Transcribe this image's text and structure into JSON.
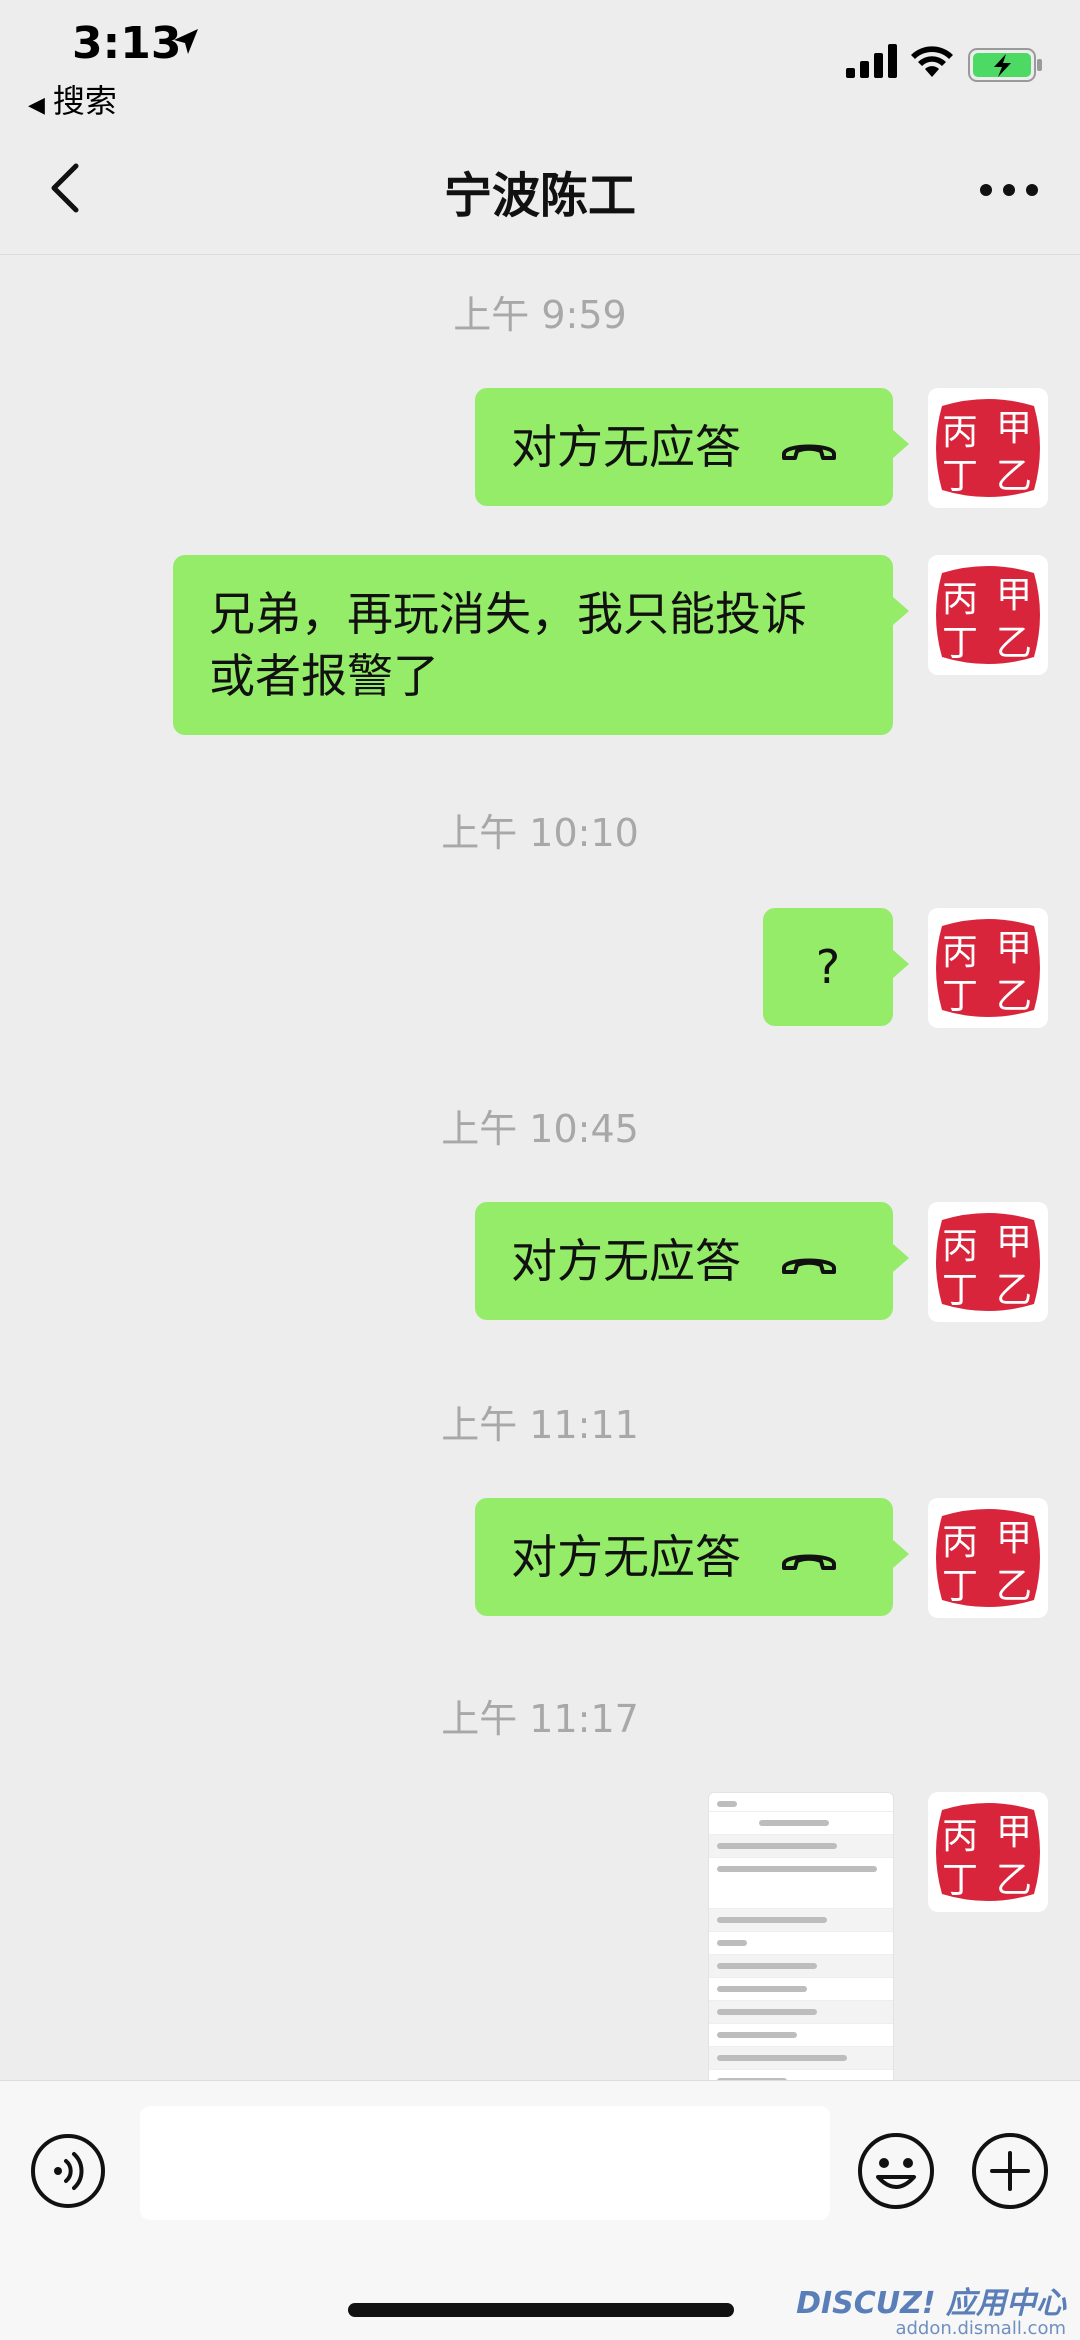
{
  "status_bar": {
    "time": "3:13",
    "back_app": "搜索"
  },
  "nav": {
    "title": "宁波陈工"
  },
  "messages": [
    {
      "type": "timestamp",
      "text": "上午 9:59"
    },
    {
      "type": "call",
      "text": "对方无应答"
    },
    {
      "type": "text",
      "lines": [
        "兄弟，再玩消失，我只能投诉",
        "或者报警了"
      ]
    },
    {
      "type": "timestamp",
      "text": "上午 10:10"
    },
    {
      "type": "text",
      "text": "?"
    },
    {
      "type": "timestamp",
      "text": "上午 10:45"
    },
    {
      "type": "call",
      "text": "对方无应答"
    },
    {
      "type": "timestamp",
      "text": "上午 11:11"
    },
    {
      "type": "call",
      "text": "对方无应答"
    },
    {
      "type": "timestamp",
      "text": "上午 11:17"
    },
    {
      "type": "image",
      "description": "screenshot thumbnail"
    }
  ],
  "avatar": {
    "glyphs": [
      "丙",
      "甲",
      "丁",
      "乙"
    ],
    "color": "#d9253c"
  },
  "watermark": {
    "logo": "DISCUZ! 应用中心",
    "url": "addon.dismall.com"
  },
  "colors": {
    "bubble": "#95ec69",
    "background": "#ededed",
    "timestamp": "#a8a8a8"
  }
}
